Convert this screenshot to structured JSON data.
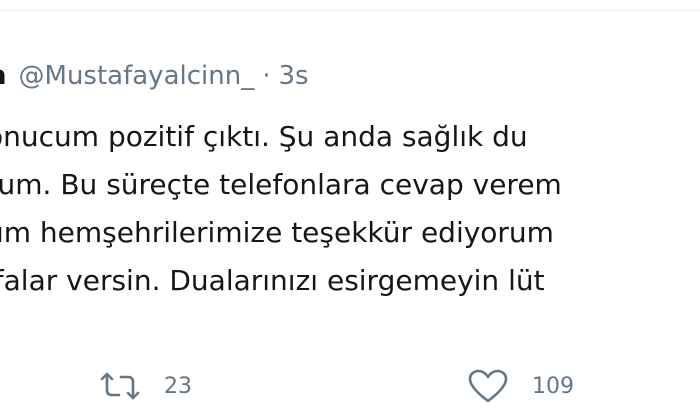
{
  "tweet": {
    "author": {
      "display_name": "n",
      "handle": "@Mustafayalcinn_"
    },
    "separator": "·",
    "timestamp": "3s",
    "lines": [
      "onucum pozitif çıktı. Şu anda sağlık du",
      "rum. Bu süreçte telefonlara cevap verem",
      "üm hemşehrilerimize teşekkür ediyorum",
      "ifalar versin. Dualarınızı esirgemeyin lüt"
    ]
  },
  "actions": {
    "retweet": {
      "icon": "retweet-icon",
      "count": "23"
    },
    "like": {
      "icon": "heart-icon",
      "count": "109"
    }
  },
  "colors": {
    "text": "#14171a",
    "secondary": "#657786",
    "divider": "#e6ecf0"
  }
}
